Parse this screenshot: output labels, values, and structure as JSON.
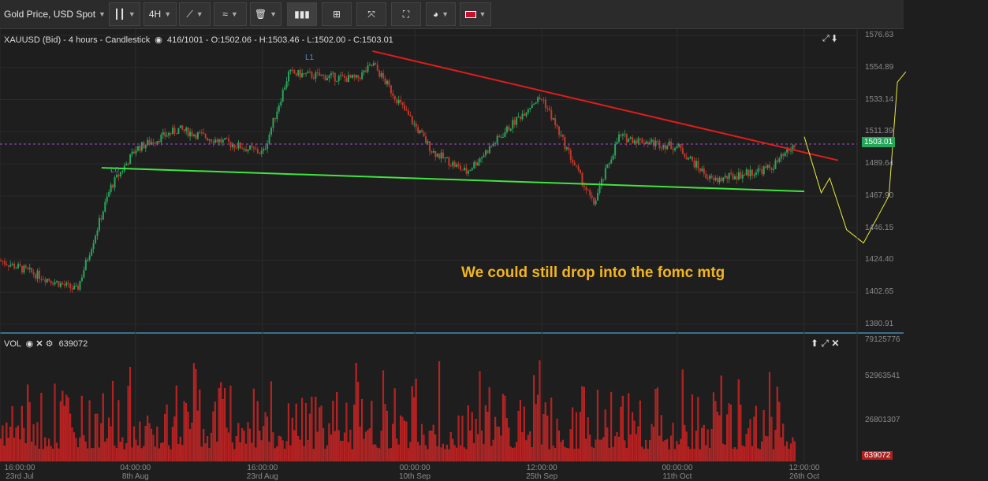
{
  "toolbar": {
    "instrument": "Gold Price, USD Spot",
    "timeframe": "4H"
  },
  "chart_header": {
    "symbol_info": "XAUUSD (Bid) - 4 hours - Candlestick",
    "candle_count": "416/1001",
    "ohlc": "O:1502.06 - H:1503.46 - L:1502.00 - C:1503.01"
  },
  "price_axis": [
    "1576.63",
    "1554.89",
    "1533.14",
    "1511.39",
    "1489.64",
    "1467.90",
    "1446.15",
    "1424.40",
    "1402.65",
    "1380.91"
  ],
  "current_price": "1503.01",
  "time_axis": [
    {
      "time": "16:00:00",
      "date": "23rd Jul"
    },
    {
      "time": "04:00:00",
      "date": "8th Aug"
    },
    {
      "time": "16:00:00",
      "date": "23rd Aug"
    },
    {
      "time": "00:00:00",
      "date": "10th Sep"
    },
    {
      "time": "12:00:00",
      "date": "25th Sep"
    },
    {
      "time": "00:00:00",
      "date": "11th Oct"
    },
    {
      "time": "12:00:00",
      "date": "26th Oct"
    }
  ],
  "annotations": {
    "label_l0": "L0",
    "label_l1": "L1",
    "note": "We could still drop into the fomc mtg"
  },
  "volume": {
    "label": "VOL",
    "value": "639072",
    "axis": [
      "79125776",
      "52963541",
      "26801307",
      "639072"
    ]
  },
  "colors": {
    "bull": "#26a65b",
    "bear": "#c0392b",
    "resistance": "#e01c1c",
    "support": "#3ee63e",
    "projection": "#e8e83a",
    "note": "#f2b51c",
    "price_line": "#a24fc9"
  },
  "chart_data": {
    "type": "candlestick",
    "y_range": [
      1380.91,
      1576.63
    ],
    "last_close": 1503.01,
    "trendlines": [
      {
        "name": "L1",
        "from": {
          "date": "5th Sep",
          "price": 1566
        },
        "to": {
          "date": "30th Oct",
          "price": 1492
        }
      },
      {
        "name": "L0",
        "from": {
          "date": "4th Aug",
          "price": 1487
        },
        "to": {
          "date": "26th Oct",
          "price": 1471
        }
      }
    ],
    "anchors": [
      {
        "date": "23rd Jul",
        "price": 1424
      },
      {
        "date": "1st Aug",
        "price": 1404
      },
      {
        "date": "5th Aug",
        "price": 1474
      },
      {
        "date": "8th Aug",
        "price": 1500
      },
      {
        "date": "13th Aug",
        "price": 1513
      },
      {
        "date": "23rd Aug",
        "price": 1497
      },
      {
        "date": "26th Aug",
        "price": 1551
      },
      {
        "date": "3rd Sep",
        "price": 1547
      },
      {
        "date": "5th Sep",
        "price": 1557
      },
      {
        "date": "12th Sep",
        "price": 1498
      },
      {
        "date": "16th Sep",
        "price": 1484
      },
      {
        "date": "24th Sep",
        "price": 1532
      },
      {
        "date": "25th Sep",
        "price": 1534
      },
      {
        "date": "1st Oct",
        "price": 1462
      },
      {
        "date": "4th Oct",
        "price": 1508
      },
      {
        "date": "11th Oct",
        "price": 1501
      },
      {
        "date": "15th Oct",
        "price": 1478
      },
      {
        "date": "22nd Oct",
        "price": 1487
      },
      {
        "date": "25th Oct",
        "price": 1503
      }
    ],
    "projection": [
      {
        "date": "26th Oct",
        "price": 1508
      },
      {
        "date": "28th Oct",
        "price": 1470
      },
      {
        "date": "29th Oct",
        "price": 1480
      },
      {
        "date": "31st Oct",
        "price": 1445
      },
      {
        "date": "2nd Nov",
        "price": 1436
      },
      {
        "date": "5th Nov",
        "price": 1468
      },
      {
        "date": "6th Nov",
        "price": 1545
      },
      {
        "date": "7th Nov",
        "price": 1552
      }
    ]
  }
}
